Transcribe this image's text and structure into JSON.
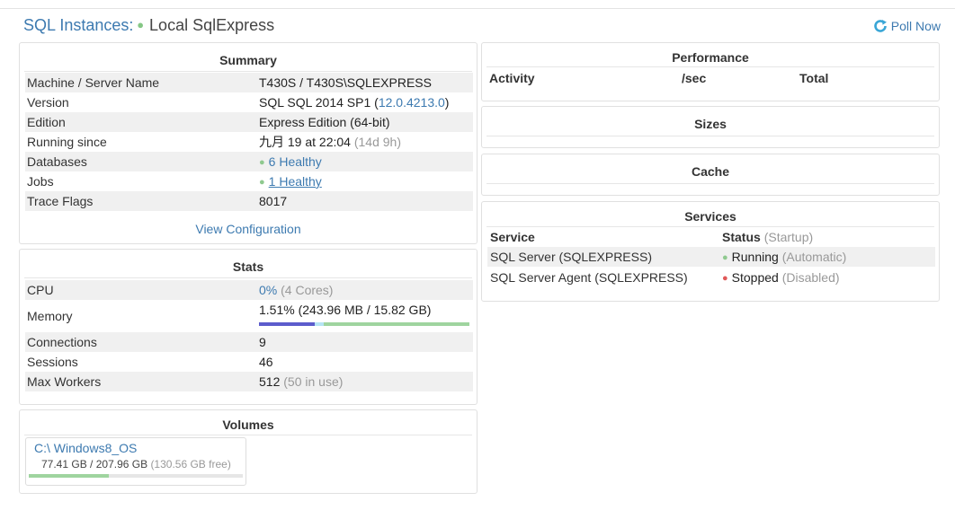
{
  "header": {
    "title": "SQL Instances:",
    "status_dot": "●",
    "instance": "Local SqlExpress",
    "poll_label": "Poll Now",
    "poll_icon": "refresh-icon"
  },
  "summary": {
    "title": "Summary",
    "rows": [
      {
        "key": "Machine / Server Name",
        "value": "T430S / T430S\\SQLEXPRESS"
      },
      {
        "key": "Version",
        "value": "SQL SQL 2014 SP1 (",
        "link": "12.0.4213.0",
        "suffix": ")"
      },
      {
        "key": "Edition",
        "value": "Express Edition (64-bit)"
      },
      {
        "key": "Running since",
        "value": "九月 19 at 22:04",
        "muted": "(14d 9h)"
      },
      {
        "key": "Databases",
        "value": "6 Healthy"
      },
      {
        "key": "Jobs",
        "value": "1 Healthy"
      },
      {
        "key": "Trace Flags",
        "value": "8017"
      }
    ],
    "view_config": "View Configuration"
  },
  "stats": {
    "title": "Stats",
    "cpu_key": "CPU",
    "cpu_value": "0%",
    "cpu_muted": "(4 Cores)",
    "memory_key": "Memory",
    "memory_value": "1.51% (243.96 MB / 15.82 GB)",
    "memory_used_pct": 1.51,
    "connections_key": "Connections",
    "connections_value": "9",
    "sessions_key": "Sessions",
    "sessions_value": "46",
    "workers_key": "Max Workers",
    "workers_value": "512",
    "workers_muted": "(50 in use)"
  },
  "volumes": {
    "title": "Volumes",
    "items": [
      {
        "name": "C:\\ Windows8_OS",
        "used": "77.41 GB",
        "total": "/ 207.96 GB",
        "free": "(130.56 GB free)",
        "used_fraction": 0.372
      }
    ]
  },
  "performance": {
    "title": "Performance",
    "col_activity": "Activity",
    "col_sec": "/sec",
    "col_total": "Total"
  },
  "sizes": {
    "title": "Sizes"
  },
  "cache": {
    "title": "Cache"
  },
  "services": {
    "title": "Services",
    "col_service": "Service",
    "col_status": "Status",
    "col_startup": "(Startup)",
    "items": [
      {
        "name": "SQL Server (SQLEXPRESS)",
        "status": "Running",
        "startup": "(Automatic)",
        "color": "#8fc98f"
      },
      {
        "name": "SQL Server Agent (SQLEXPRESS)",
        "status": "Stopped",
        "startup": "(Disabled)",
        "color": "#e05858"
      }
    ]
  },
  "colors": {
    "accent": "#3d7ab0",
    "healthy": "#8fc98f",
    "stopped": "#e05858",
    "memory_used": "#5c5ccc"
  }
}
